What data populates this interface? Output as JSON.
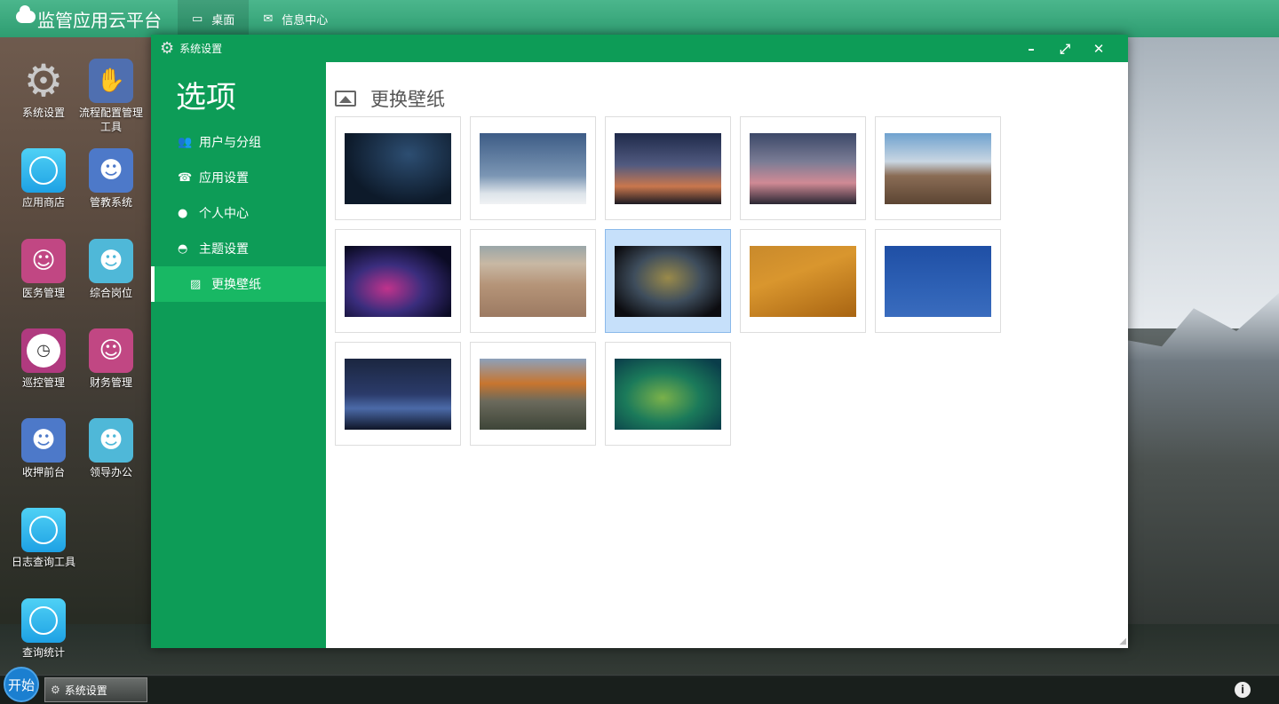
{
  "app": {
    "title": "监管应用云平台"
  },
  "top_tabs": [
    {
      "label": "桌面",
      "icon": "monitor-icon"
    },
    {
      "label": "信息中心",
      "icon": "mail-icon"
    }
  ],
  "desktop_icons": [
    {
      "label": "系统设置",
      "icon": "gear-icon"
    },
    {
      "label": "流程配置管理工具",
      "icon": "book-hand-icon"
    },
    {
      "label": "应用商店",
      "icon": "apple-icon"
    },
    {
      "label": "管教系统",
      "icon": "officer-icon"
    },
    {
      "label": "医务管理",
      "icon": "nurse-icon"
    },
    {
      "label": "综合岗位",
      "icon": "man-glasses-icon"
    },
    {
      "label": "巡控管理",
      "icon": "clock-icon"
    },
    {
      "label": "财务管理",
      "icon": "nurse-icon"
    },
    {
      "label": "收押前台",
      "icon": "businessman-icon"
    },
    {
      "label": "领导办公",
      "icon": "man-glasses-icon"
    },
    {
      "label": "日志查询工具",
      "icon": "apple-icon"
    },
    {
      "label": "查询统计",
      "icon": "apple-icon"
    }
  ],
  "window": {
    "title": "系统设置",
    "controls": {
      "minimize": "–",
      "maximize": "⤢",
      "close": "✕"
    },
    "sidebar": {
      "title": "选项",
      "items": [
        {
          "label": "用户与分组",
          "icon": "users-icon"
        },
        {
          "label": "应用设置",
          "icon": "phone-icon"
        },
        {
          "label": "个人中心",
          "icon": "user-icon"
        },
        {
          "label": "主题设置",
          "icon": "dashboard-icon"
        },
        {
          "label": "更换壁纸",
          "icon": "image-icon",
          "active": true
        }
      ]
    },
    "content": {
      "title": "更换壁纸",
      "wallpapers": [
        {
          "name": "starry-night"
        },
        {
          "name": "snowy-plain"
        },
        {
          "name": "sunset-tree"
        },
        {
          "name": "dusk-sky"
        },
        {
          "name": "hay-bale-field"
        },
        {
          "name": "colorful-waves"
        },
        {
          "name": "beach-shell"
        },
        {
          "name": "blurred-lights",
          "selected": true
        },
        {
          "name": "desert-dunes"
        },
        {
          "name": "blue-sky-roof"
        },
        {
          "name": "night-mountains"
        },
        {
          "name": "yosemite-cliff"
        },
        {
          "name": "green-blur"
        }
      ]
    }
  },
  "taskbar": {
    "start_label": "开始",
    "items": [
      {
        "label": "系统设置",
        "icon": "gear-icon"
      }
    ],
    "info_icon": "info-icon"
  },
  "colors": {
    "window_green": "#0d9c57",
    "active_item": "#18b864",
    "topbar": "#2e9d71",
    "selected_thumb": "#c6e0fa"
  }
}
